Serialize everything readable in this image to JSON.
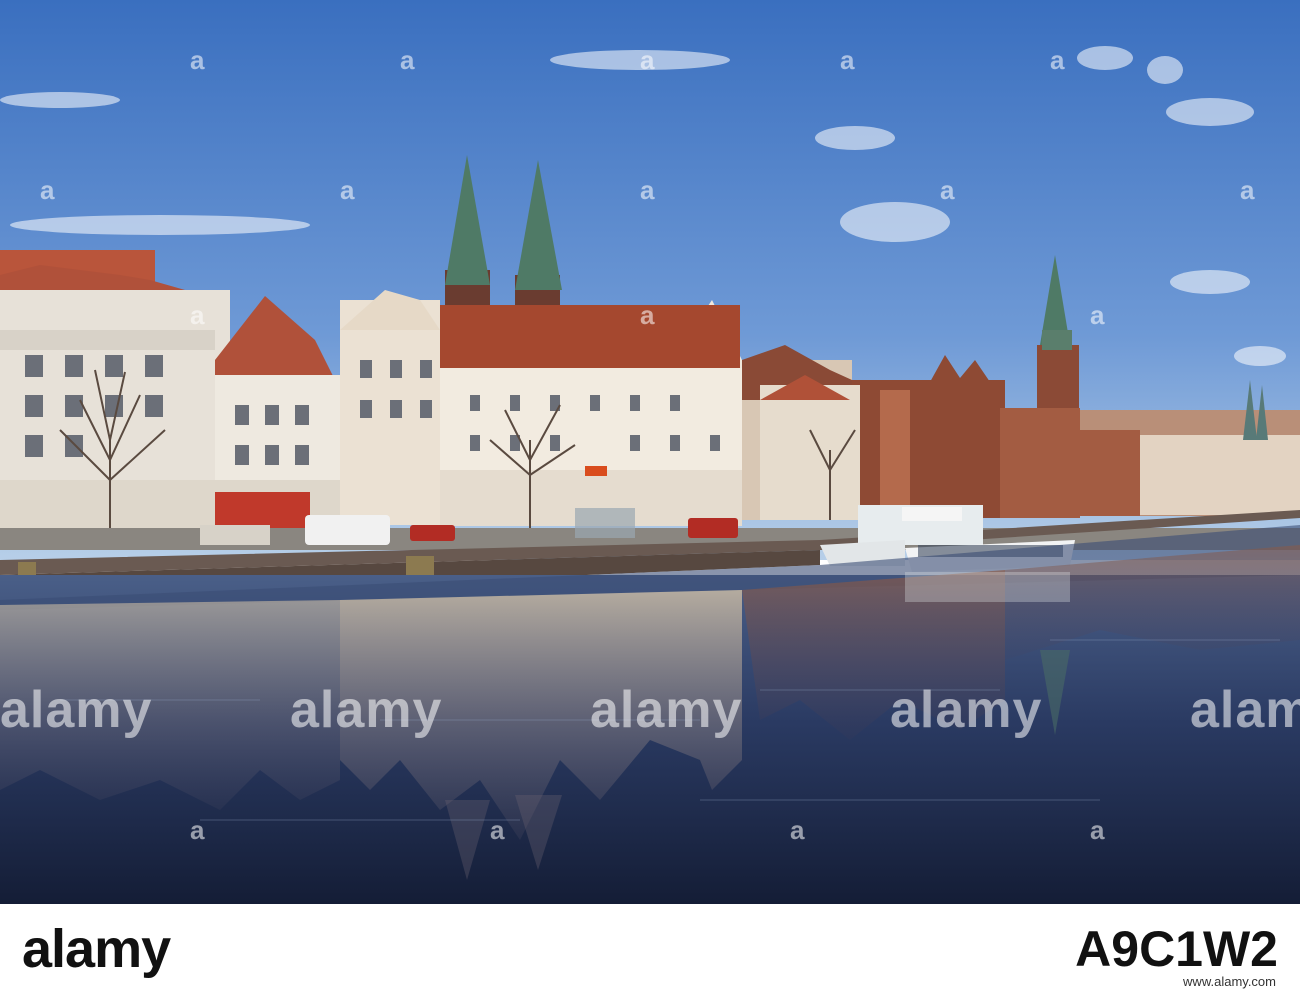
{
  "watermark": {
    "brand_small": "a",
    "brand_big": "alamy"
  },
  "footer": {
    "logo": "alamy",
    "image_id": "A9C1W2",
    "url": "www.alamy.com"
  },
  "colors": {
    "sky_top": "#3f76c4",
    "sky_bottom": "#a9c7e6",
    "water_top": "#3a4f7a",
    "water_bottom": "#17223c",
    "spire": "#4f7a66",
    "roof": "#a5482f",
    "brick": "#8e4a34",
    "facade": "#efe6da"
  }
}
